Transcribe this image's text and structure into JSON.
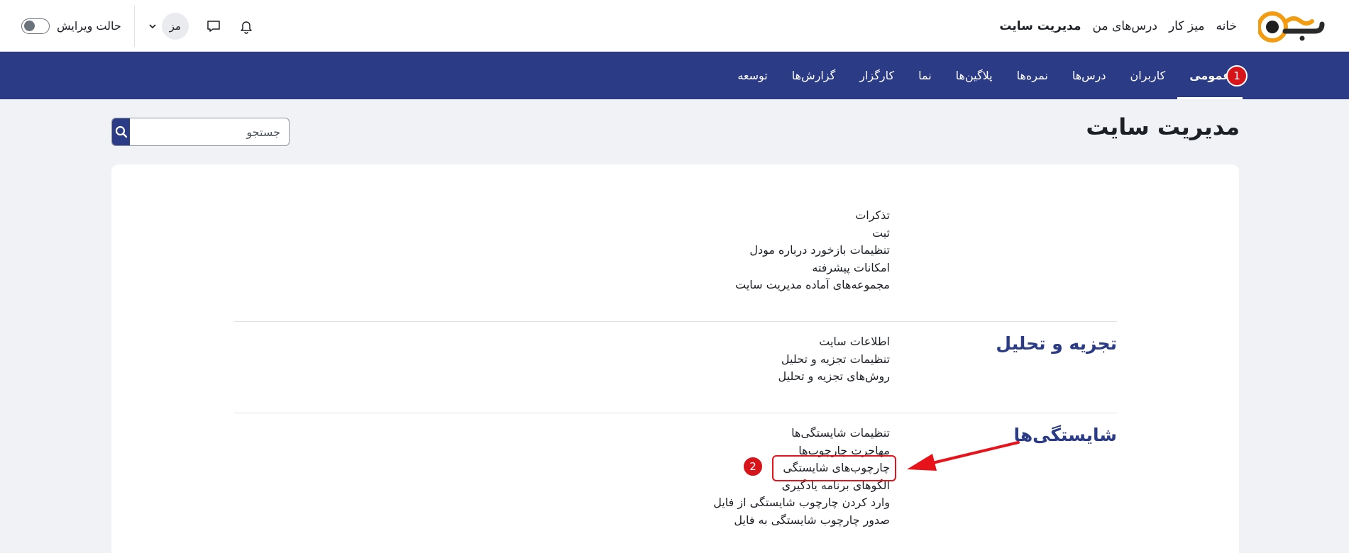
{
  "topbar": {
    "logo_alt": "logo",
    "nav": [
      {
        "label": "خانه",
        "active": false
      },
      {
        "label": "میز کار",
        "active": false
      },
      {
        "label": "درس‌های من",
        "active": false
      },
      {
        "label": "مدیریت سایت",
        "active": true
      }
    ],
    "edit_mode_label": "حالت ویرایش",
    "avatar_initials": "مز"
  },
  "subnav": {
    "items": [
      {
        "label": "عمومی",
        "active": true
      },
      {
        "label": "کاربران"
      },
      {
        "label": "درس‌ها"
      },
      {
        "label": "نمره‌ها"
      },
      {
        "label": "پلاگین‌ها"
      },
      {
        "label": "نما"
      },
      {
        "label": "کارگزار"
      },
      {
        "label": "گزارش‌ها"
      },
      {
        "label": "توسعه"
      }
    ]
  },
  "page": {
    "title": "مدیریت سایت",
    "search_placeholder": "جستجو"
  },
  "sections": [
    {
      "heading": "",
      "links": [
        "تذکرات",
        "ثبت",
        "تنظیمات بازخورد درباره مودل",
        "امکانات پیشرفته",
        "مجموعه‌های آماده مدیریت سایت"
      ]
    },
    {
      "heading": "تجزیه و تحلیل",
      "links": [
        "اطلاعات سایت",
        "تنظیمات تجزیه و تحلیل",
        "روش‌های تجزیه و تحلیل"
      ]
    },
    {
      "heading": "شایستگی‌ها",
      "links": [
        "تنظیمات شایستگی‌ها",
        "مهاجرت چارچوب‌ها",
        "چارچوب‌های شایستگی",
        "الگوهای برنامه یادگیری",
        "وارد کردن چارچوب شایستگی از فایل",
        "صدور چارچوب شایستگی به فایل"
      ]
    }
  ],
  "annotations": {
    "marker_1": "1",
    "marker_2": "2",
    "color": "#e8121a"
  },
  "colors": {
    "brand_navy": "#2b3b86",
    "background": "#f1f2f6",
    "logo_orange": "#f39c12"
  }
}
